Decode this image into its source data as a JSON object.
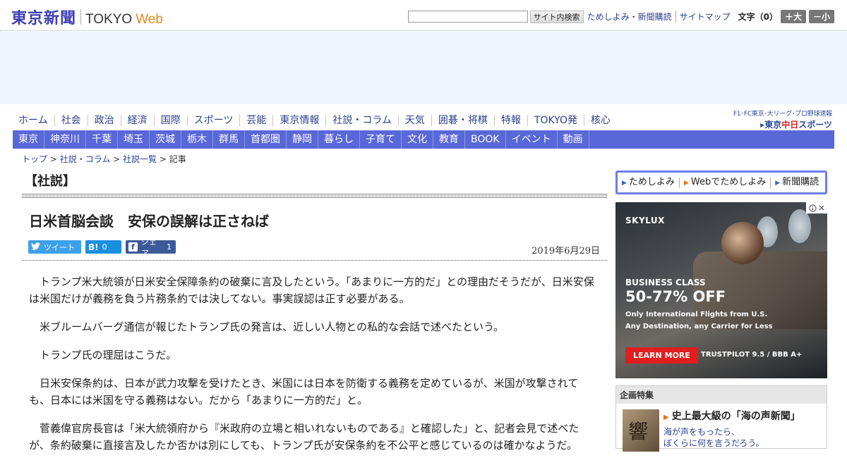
{
  "header": {
    "logo_jp": "東京新聞",
    "logo_en": "TOKYO",
    "logo_web": "Web",
    "search_placeholder": "",
    "search_button": "サイト内検索",
    "links": [
      "ためしよみ・新聞購読",
      "サイトマップ"
    ],
    "font_size_label": "文字",
    "font_size_value": "（0）",
    "font_up": "＋大",
    "font_down": "－小"
  },
  "nav_primary": [
    "ホーム",
    "社会",
    "政治",
    "経済",
    "国際",
    "スポーツ",
    "芸能",
    "東京情報",
    "社説・コラム",
    "天気",
    "囲碁・将棋",
    "特報",
    "TOKYO発",
    "核心"
  ],
  "sports_logo": {
    "top": "F1･FC東京･大リーグ･プロ野球速報",
    "main_prefix": "東京",
    "main_red": "中日",
    "main_suffix": "スポーツ"
  },
  "nav_regions": [
    "東京",
    "神奈川",
    "千葉",
    "埼玉",
    "茨城",
    "栃木",
    "群馬",
    "首都圏",
    "静岡",
    "暮らし",
    "子育て",
    "文化",
    "教育",
    "BOOK",
    "イベント",
    "動画"
  ],
  "breadcrumb": {
    "items": [
      "トップ",
      "社説・コラム",
      "社説一覧"
    ],
    "current": "記事",
    "sep": " > "
  },
  "article": {
    "section": "【社説】",
    "headline": "日米首脳会談　安保の誤解は正さねば",
    "date": "2019年6月29日",
    "share": {
      "twitter": "ツイート",
      "hatena_icon": "B!",
      "hatena_count": "0",
      "facebook_icon": "f",
      "facebook": "シェア",
      "facebook_count": "1"
    },
    "paragraphs": [
      "トランプ米大統領が日米安全保障条約の破棄に言及したという。「あまりに一方的だ」との理由だそうだが、日米安保は米国だけが義務を負う片務条約では決してない。事実誤認は正す必要がある。",
      "米ブルームバーグ通信が報じたトランプ氏の発言は、近しい人物との私的な会話で述べたという。",
      "トランプ氏の理屈はこうだ。",
      "日米安保条約は、日本が武力攻撃を受けたとき、米国には日本を防衛する義務を定めているが、米国が攻撃されても、日本には米国を守る義務はない。だから「あまりに一方的だ」と。",
      "菅義偉官房長官は「米大統領府から『米政府の立場と相いれないものである』と確認した」と、記者会見で述べたが、条約破棄に直接言及したか否かは別にしても、トランプ氏が安保条約を不公平と感じているのは確かなようだ。"
    ]
  },
  "sidebar": {
    "links": [
      "ためしよみ",
      "Webでためしよみ",
      "新聞購読"
    ],
    "ad": {
      "brand": "SKYLUX",
      "class": "BUSINESS CLASS",
      "offer": "50-77% OFF",
      "line1": "Only International Flights from U.S.",
      "line2": "Any Destination, any Carrier for Less",
      "cta": "LEARN MORE",
      "trust": "TRUSTPILOT 9.5 / BBB A+"
    },
    "feature": {
      "head": "企画特集",
      "title": "史上最大級の「海の声新聞」",
      "sub1": "海が声をもったら、",
      "sub2": "ぼくらに何を言うだろう。"
    }
  },
  "colors": {
    "brand": "#3e3eb5",
    "nav_bar": "#5968d8",
    "link": "#2d3f8f",
    "accent_orange": "#e58a1a"
  }
}
